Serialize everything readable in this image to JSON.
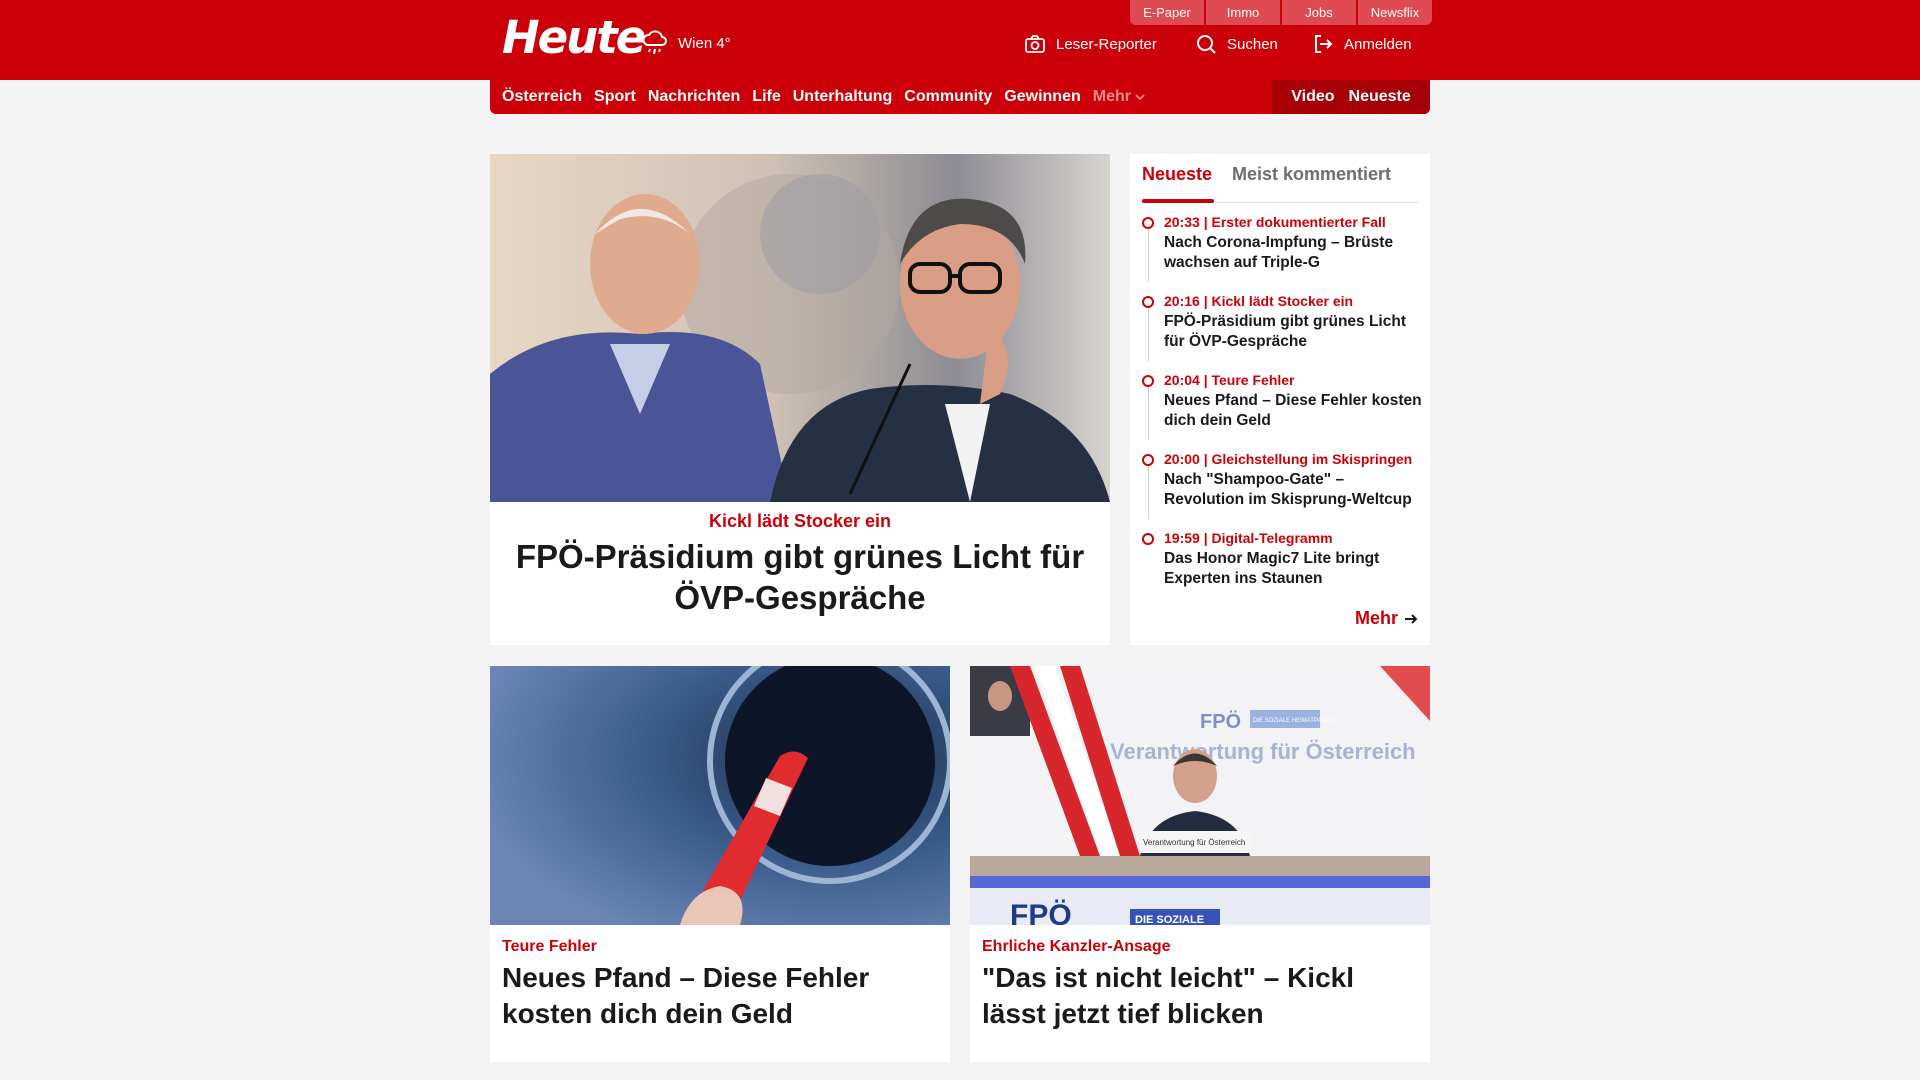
{
  "header": {
    "logo": "Heute",
    "weather": {
      "icon": "rain-cloud-icon",
      "text": "Wien 4°"
    },
    "top_links": [
      "E-Paper",
      "Immo",
      "Jobs",
      "Newsflix"
    ],
    "actions": {
      "leser_reporter": "Leser-Reporter",
      "search": "Suchen",
      "login": "Anmelden"
    },
    "brand_color": "#cc0009"
  },
  "nav": {
    "items": [
      "Österreich",
      "Sport",
      "Nachrichten",
      "Life",
      "Unterhaltung",
      "Community",
      "Gewinnen"
    ],
    "more": "Mehr",
    "video": "Video",
    "newest": "Neueste"
  },
  "hero": {
    "kicker": "Kickl lädt Stocker ein",
    "title": "FPÖ-Präsidium gibt grünes Licht für ÖVP-Gespräche"
  },
  "sidebar": {
    "tabs": [
      "Neueste",
      "Meist kommentiert"
    ],
    "items": [
      {
        "meta": "20:33 | Erster dokumentierter Fall",
        "title": "Nach Corona-Impfung – Brüste wachsen auf Triple-G"
      },
      {
        "meta": "20:16 | Kickl lädt Stocker ein",
        "title": "FPÖ-Präsidium gibt grünes Licht für ÖVP-Gespräche"
      },
      {
        "meta": "20:04 | Teure Fehler",
        "title": "Neues Pfand – Diese Fehler kosten dich dein Geld"
      },
      {
        "meta": "20:00 | Gleichstellung im Skispringen",
        "title": "Nach \"Shampoo-Gate\" – Revolution im Skisprung-Weltcup"
      },
      {
        "meta": "19:59 | Digital-Telegramm",
        "title": "Das Honor Magic7 Lite bringt Experten ins Staunen"
      }
    ],
    "more": "Mehr"
  },
  "cards": [
    {
      "kicker": "Teure Fehler",
      "title": "Neues Pfand – Diese Fehler kosten dich dein Geld"
    },
    {
      "kicker": "Ehrliche Kanzler-Ansage",
      "title": "\"Das ist nicht leicht\" – Kickl lässt jetzt tief blicken",
      "image_text": {
        "banner": "Verantwortung für Österreich",
        "logo": "FPÖ",
        "logo_tag": "DIE SOZIALE HEIMATPARTEI",
        "podium": "Verantwortung für Österreich",
        "front": "FPÖ",
        "front_tag": "DIE SOZIALE"
      }
    }
  ]
}
